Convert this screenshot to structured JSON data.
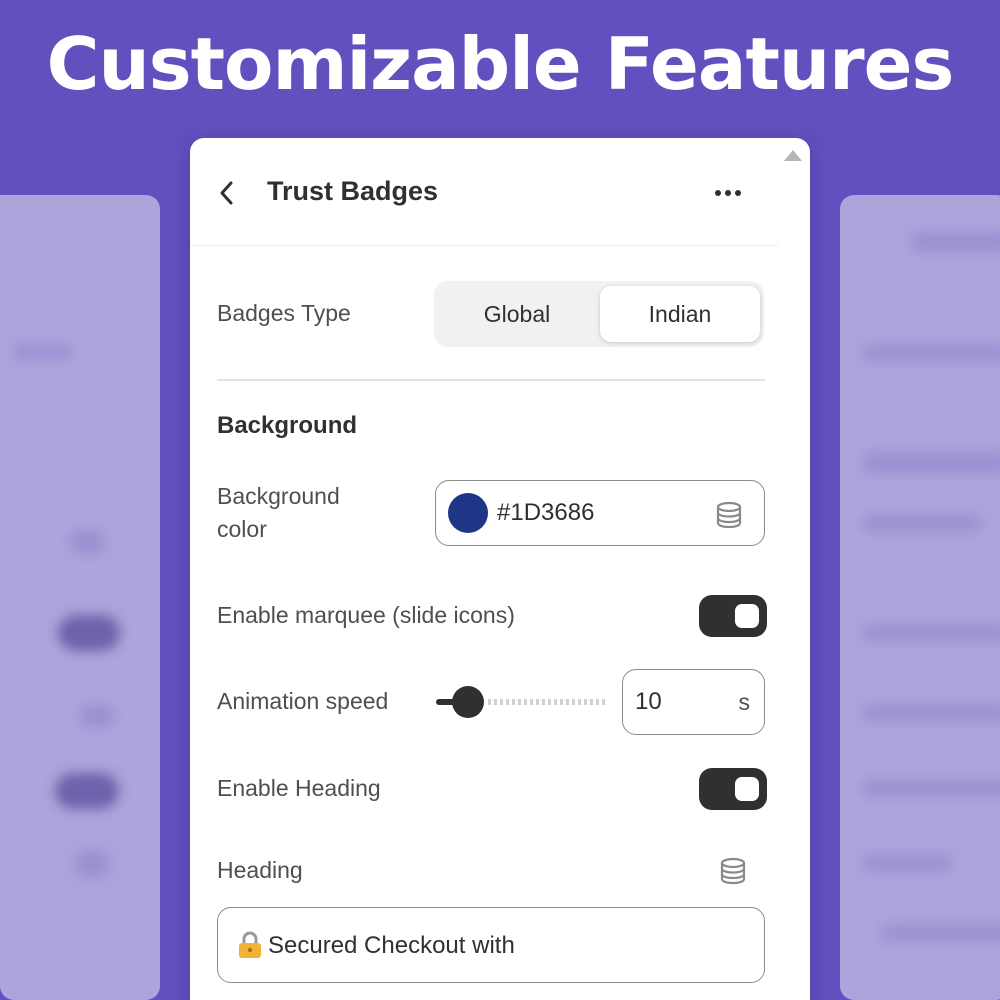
{
  "banner": {
    "title": "Customizable Features"
  },
  "panel": {
    "title": "Trust Badges",
    "badges_type": {
      "label": "Badges Type",
      "options": [
        "Global",
        "Indian"
      ],
      "selected": "Indian"
    },
    "background_section": {
      "title": "Background",
      "color_label_line1": "Background",
      "color_label_line2": "color",
      "color_value": "#1D3686",
      "swatch_color": "#1d3686"
    },
    "marquee": {
      "label": "Enable marquee (slide icons)",
      "enabled": true
    },
    "animation_speed": {
      "label": "Animation speed",
      "value": "10",
      "unit": "s",
      "slider_fraction": 0.1
    },
    "enable_heading": {
      "label": "Enable Heading",
      "enabled": true
    },
    "heading": {
      "label": "Heading",
      "value": "Secured Checkout with"
    }
  },
  "colors": {
    "brand_background": "#6150bd",
    "toggle_on": "#303030"
  },
  "icons": {
    "back": "chevron-left-icon",
    "more": "more-horizontal-icon",
    "dynamic_source": "database-icon",
    "heading_prefix": "lock-icon"
  }
}
